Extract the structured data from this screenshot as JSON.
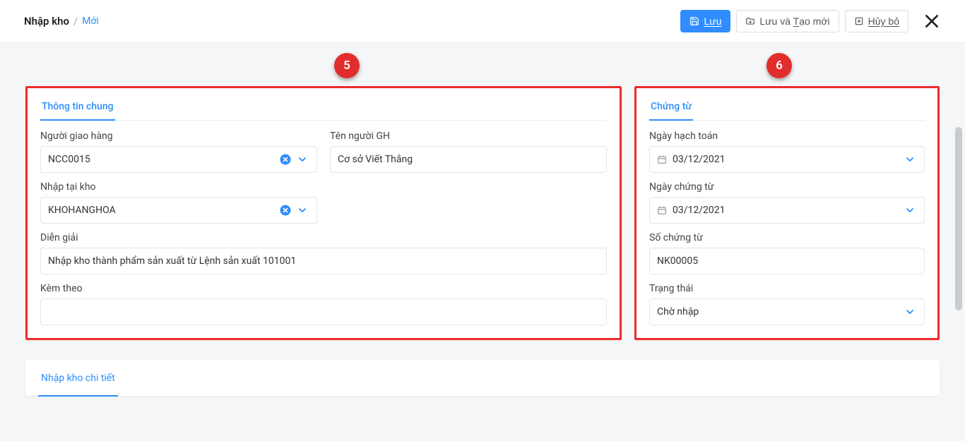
{
  "breadcrumb": {
    "main": "Nhập kho",
    "sub": "Mới"
  },
  "header_actions": {
    "save_label": "Lưu",
    "save_new_label": "Lưu và Tạo mới",
    "cancel_label": "Hủy bỏ"
  },
  "callouts": {
    "c5": "5",
    "c6": "6"
  },
  "panel_general": {
    "tab": "Thông tin chung",
    "deliverer_label": "Người giao hàng",
    "deliverer_value": "NCC0015",
    "deliverer_name_label": "Tên người GH",
    "deliverer_name_value": "Cơ sở Viết Thắng",
    "warehouse_label": "Nhập tại kho",
    "warehouse_value": "KHOHANGHOA",
    "desc_label": "Diễn giải",
    "desc_value": "Nhập kho thành phẩm sản xuất từ Lệnh sản xuất 101001",
    "attach_label": "Kèm theo",
    "attach_value": ""
  },
  "panel_voucher": {
    "tab": "Chứng từ",
    "posting_date_label": "Ngày hạch toán",
    "posting_date_value": "03/12/2021",
    "voucher_date_label": "Ngày chứng từ",
    "voucher_date_value": "03/12/2021",
    "voucher_no_label": "Số chứng từ",
    "voucher_no_value": "NK00005",
    "status_label": "Trạng thái",
    "status_value": "Chờ nhập"
  },
  "detail": {
    "tab": "Nhập kho chi tiết"
  }
}
